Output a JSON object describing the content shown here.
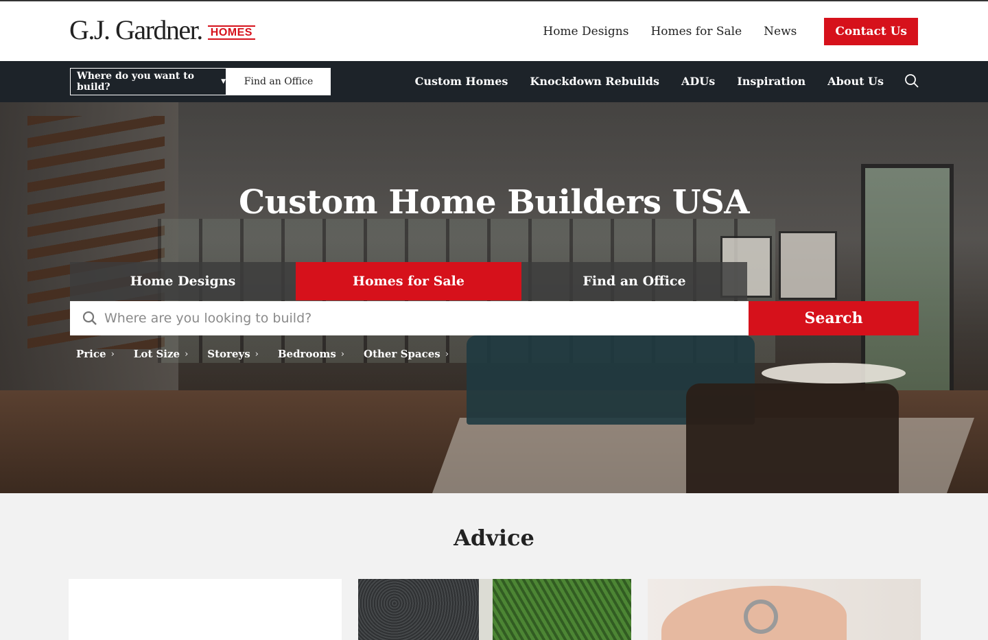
{
  "header": {
    "logo_text": "G.J. Gardner.",
    "logo_homes": "HOMES",
    "nav": [
      "Home Designs",
      "Homes for Sale",
      "News"
    ],
    "contact_label": "Contact Us"
  },
  "navbar": {
    "location_label": "Where do you want to build?",
    "find_office_label": "Find an Office",
    "items": [
      "Custom Homes",
      "Knockdown Rebuilds",
      "ADUs",
      "Inspiration",
      "About Us"
    ],
    "search_icon": "search-icon"
  },
  "hero": {
    "title": "Custom Home Builders USA",
    "tabs": [
      {
        "label": "Home Designs",
        "active": false
      },
      {
        "label": "Homes for Sale",
        "active": true
      },
      {
        "label": "Find an Office",
        "active": false
      }
    ],
    "search_placeholder": "Where are you looking to build?",
    "search_button": "Search",
    "filters": [
      "Price",
      "Lot Size",
      "Storeys",
      "Bedrooms",
      "Other Spaces"
    ]
  },
  "advice": {
    "title": "Advice"
  },
  "colors": {
    "brand_red": "#d6111b",
    "navbar_bg": "#1d2329",
    "page_bg": "#f2f2f2"
  }
}
